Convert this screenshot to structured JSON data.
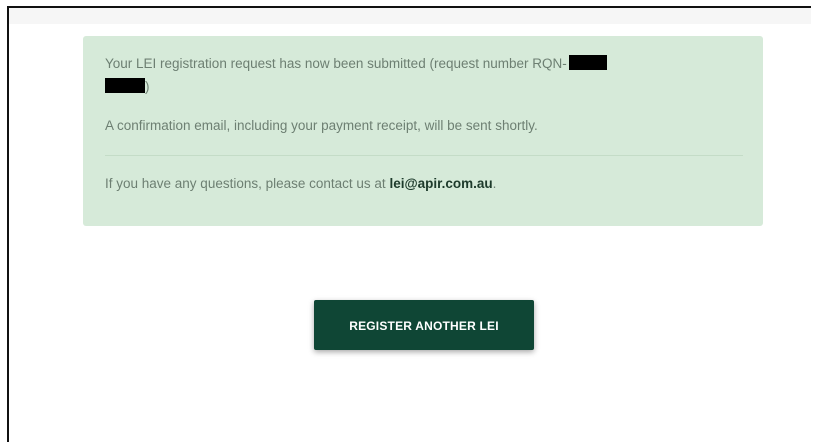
{
  "alert": {
    "message_prefix": "Your LEI registration request has now been submitted (request number RQN-",
    "message_suffix": ")",
    "confirmation": "A confirmation email, including your payment receipt, will be sent shortly.",
    "contact_prefix": "If you have any questions, please contact us at ",
    "contact_email": "lei@apir.com.au",
    "contact_suffix": ".",
    "background_color": "#d6ead9",
    "text_color": "#6d7f72"
  },
  "actions": {
    "register_another_label": "REGISTER ANOTHER LEI",
    "button_color": "#0f4635"
  }
}
